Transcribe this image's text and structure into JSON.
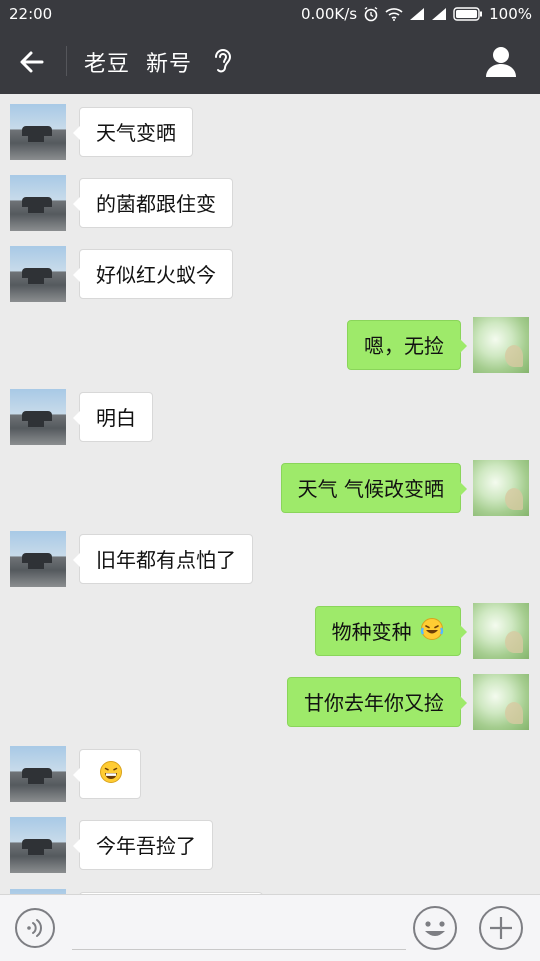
{
  "status_bar": {
    "time": "22:00",
    "network_speed": "0.00K/s",
    "battery": "100%",
    "icons": [
      "alarm-icon",
      "wifi-icon",
      "signal-icon",
      "signal-icon-2",
      "battery-icon"
    ]
  },
  "header": {
    "title": "老豆  新号",
    "back_icon": "back-arrow-icon",
    "mode_icon": "ear-icon",
    "profile_icon": "person-icon"
  },
  "messages": [
    {
      "side": "left",
      "text": "天气变晒"
    },
    {
      "side": "left",
      "text": "的菌都跟住变"
    },
    {
      "side": "left",
      "text": "好似红火蚁今"
    },
    {
      "side": "right",
      "text": "嗯，无捡"
    },
    {
      "side": "left",
      "text": "明白"
    },
    {
      "side": "right",
      "text": "天气 气候改变晒"
    },
    {
      "side": "left",
      "text": "旧年都有点怕了"
    },
    {
      "side": "right",
      "text": "物种变种",
      "emoji": "laughing-tears-emoji"
    },
    {
      "side": "right",
      "text": "甘你去年你又捡"
    },
    {
      "side": "left",
      "text": "",
      "emoji": "grin-emoji"
    },
    {
      "side": "left",
      "text": "今年吾捡了"
    }
  ],
  "input_bar": {
    "voice_icon": "voice-icon",
    "input_value": "",
    "emoji_icon": "smiley-icon",
    "plus_icon": "plus-icon"
  },
  "colors": {
    "bar": "#393a3f",
    "chat_bg": "#ebebeb",
    "bubble_self": "#9eea6a",
    "bubble_other": "#ffffff"
  }
}
